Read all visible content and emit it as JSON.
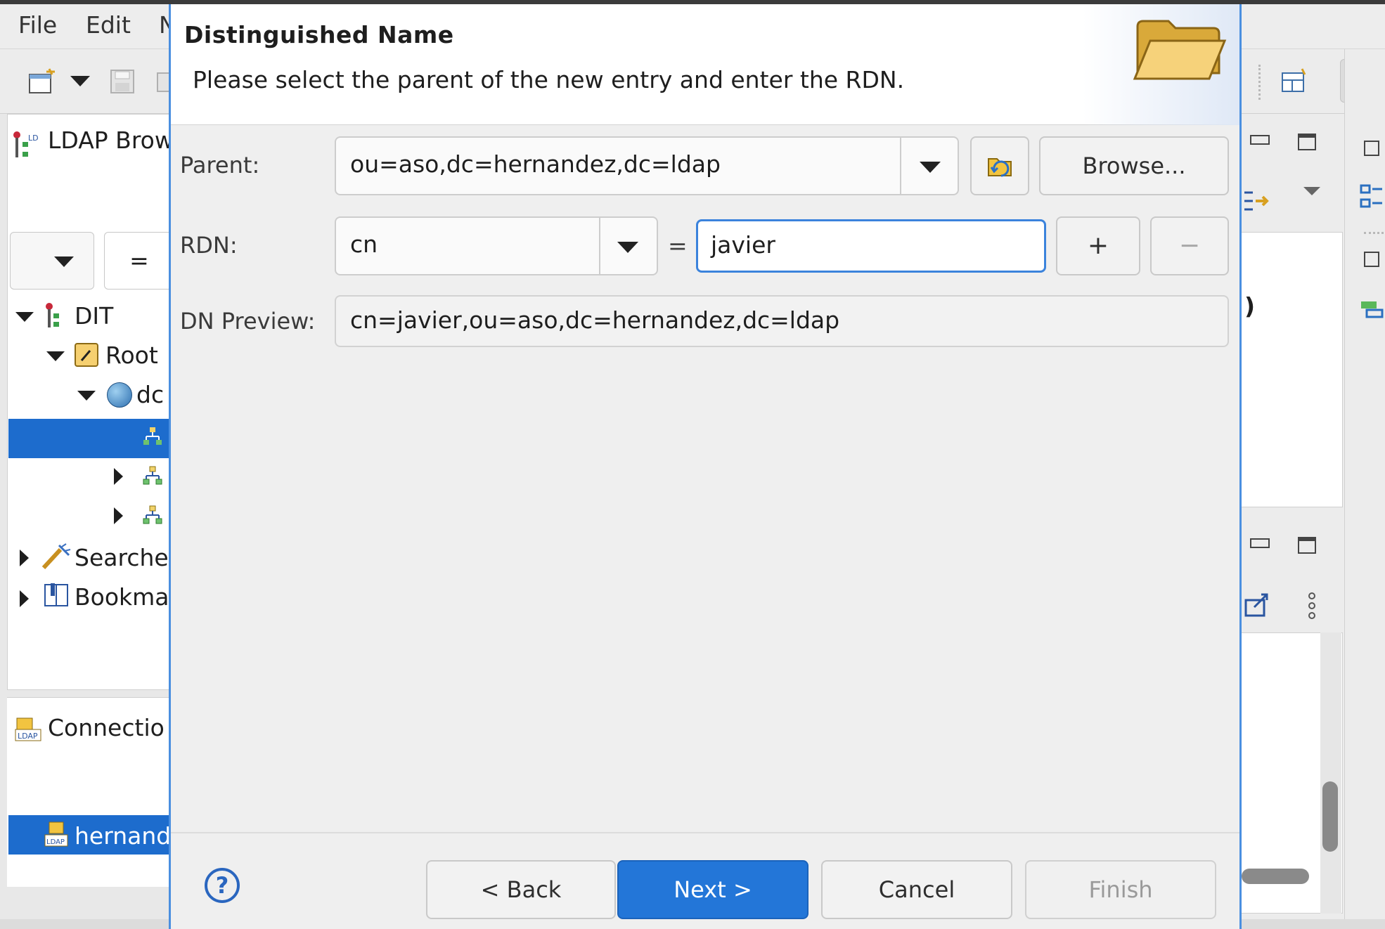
{
  "menu": {
    "file": "File",
    "edit": "Edit",
    "next_partial": "N"
  },
  "left_view": {
    "title": "LDAP Brow",
    "filter_operator": "=",
    "tree": {
      "dit": "DIT",
      "root": "Root",
      "dc": "dc",
      "searches": "Searche",
      "bookmarks": "Bookma"
    }
  },
  "connections_view": {
    "title": "Connectio",
    "selected_connection": "hernand"
  },
  "right_view": {
    "paren_text": ")"
  },
  "dialog": {
    "title": "Distinguished Name",
    "subtitle": "Please select the parent of the new entry and enter the RDN.",
    "parent_label": "Parent:",
    "parent_value": "ou=aso,dc=hernandez,dc=ldap",
    "browse_label": "Browse...",
    "rdn_label": "RDN:",
    "rdn_attribute": "cn",
    "rdn_equals": "=",
    "rdn_value": "javier",
    "add_label": "+",
    "remove_label": "−",
    "dn_preview_label": "DN Preview:",
    "dn_preview_value": "cn=javier,ou=aso,dc=hernandez,dc=ldap",
    "help_label": "?",
    "back_label": "< Back",
    "next_label": "Next >",
    "cancel_label": "Cancel",
    "finish_label": "Finish"
  },
  "colors": {
    "accent": "#2376d8",
    "selection": "#1d6ccd",
    "dialog_border": "#4a8fe0"
  }
}
